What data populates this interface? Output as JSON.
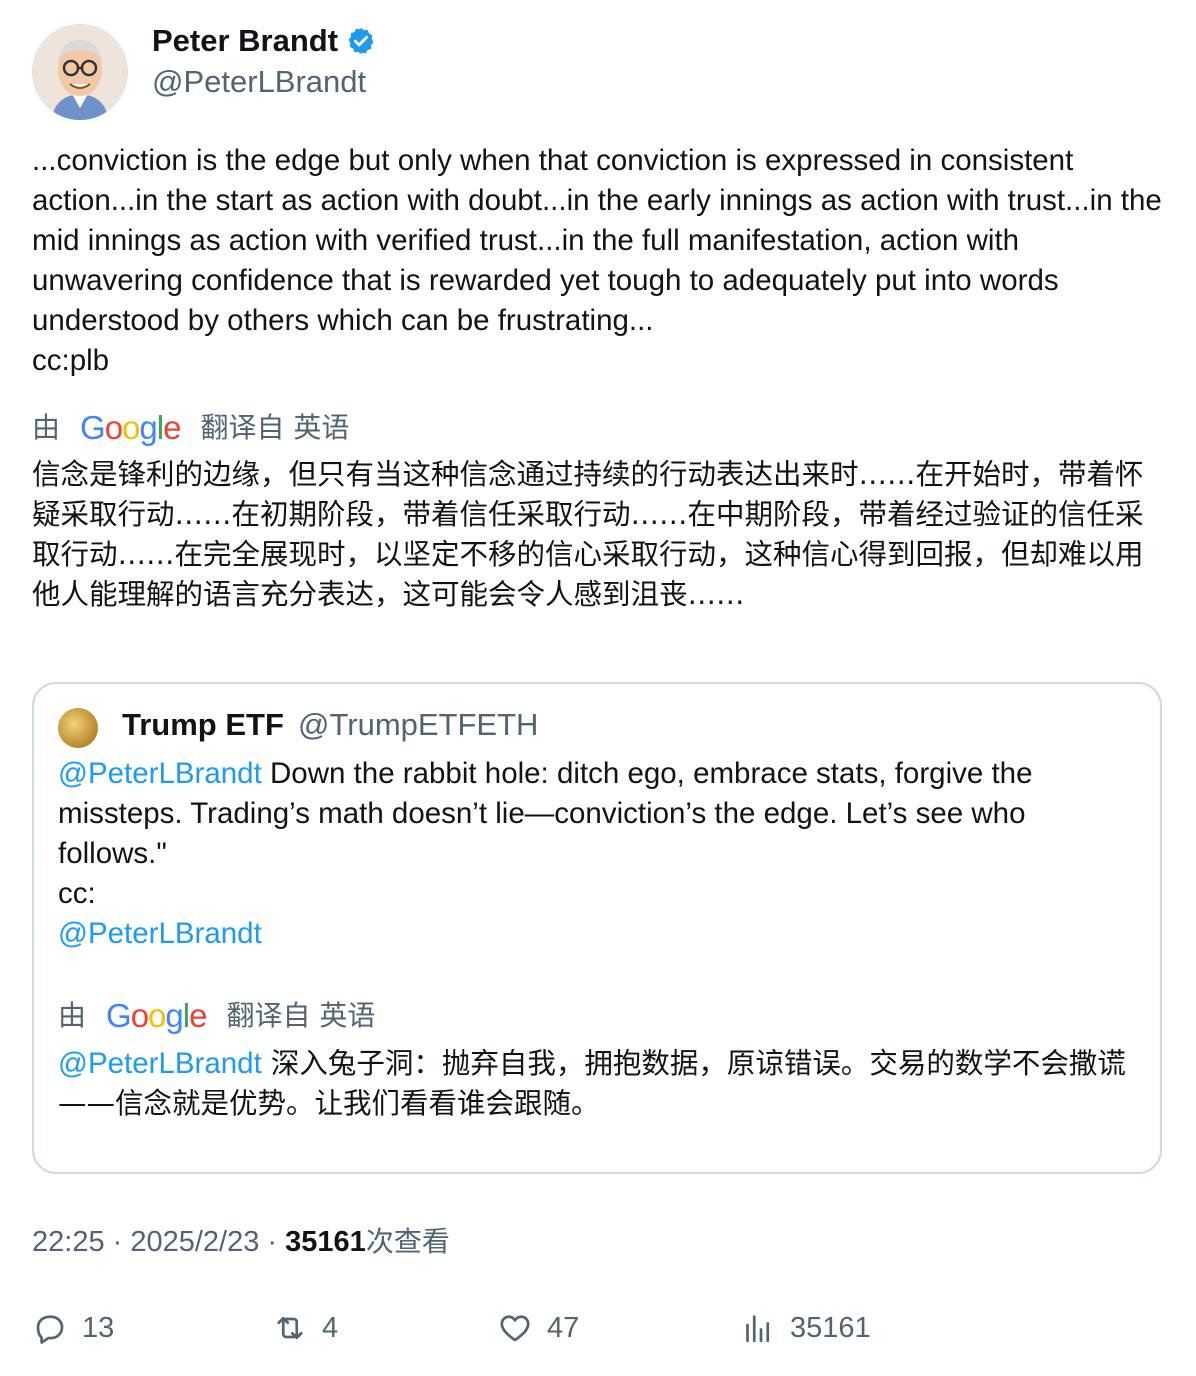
{
  "author": {
    "name": "Peter Brandt",
    "handle": "@PeterLBrandt"
  },
  "tweet": {
    "text": "...conviction is the edge but only when that conviction is expressed in consistent action...in the start as action with doubt...in the early innings as action with trust...in the mid innings as action with verified trust...in the full manifestation, action with unwavering confidence that is rewarded yet tough to adequately put into words understood by others which can be frustrating...\ncc:plb",
    "translate_prefix": "由",
    "translate_brand": "Google",
    "translate_suffix": "翻译自 英语",
    "translated_text": "信念是锋利的边缘，但只有当这种信念通过持续的行动表达出来时……在开始时，带着怀疑采取行动……在初期阶段，带着信任采取行动……在中期阶段，带着经过验证的信任采取行动……在完全展现时，以坚定不移的信心采取行动，这种信心得到回报，但却难以用他人能理解的语言充分表达，这可能会令人感到沮丧……"
  },
  "quote": {
    "name": "Trump ETF",
    "handle": "@TrumpETFETH",
    "mention": "@PeterLBrandt",
    "text_main": " Down the rabbit hole: ditch ego, embrace stats, forgive the missteps. Trading’s math doesn’t lie—conviction’s the edge. Let’s see who follows.\"",
    "cc_label": "cc:",
    "cc_mention": "@PeterLBrandt",
    "translate_prefix": "由",
    "translate_brand": "Google",
    "translate_suffix": "翻译自 英语",
    "translated_mention": "@PeterLBrandt",
    "translated_text": " 深入兔子洞：抛弃自我，拥抱数据，原谅错误。交易的数学不会撒谎——信念就是优势。让我们看看谁会跟随。"
  },
  "meta": {
    "time": "22:25",
    "sep": " · ",
    "date": "2025/2/23",
    "views_count": "35161",
    "views_label": "次查看"
  },
  "actions": {
    "replies": "13",
    "retweets": "4",
    "likes": "47",
    "views": "35161"
  },
  "colors": {
    "link": "#1d9bf0",
    "secondary_text": "#536471",
    "verified": "#1d9bf0"
  },
  "icons": [
    "verified-badge-icon",
    "reply-icon",
    "retweet-icon",
    "like-icon",
    "views-icon",
    "google-logo"
  ]
}
